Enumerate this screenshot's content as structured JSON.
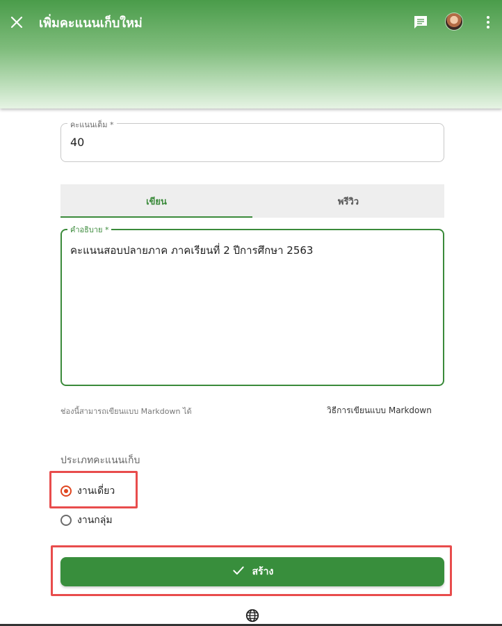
{
  "header": {
    "title": "เพิ่มคะแนนเก็บใหม่",
    "close_icon": "close-icon",
    "chat_icon": "chat-icon",
    "more_icon": "more-vert-icon",
    "gradient_top": "#4a9c4a"
  },
  "form": {
    "max_score": {
      "label": "คะแนนเต็ม *",
      "value": "40"
    },
    "tabs": [
      {
        "label": "เขียน",
        "active": true
      },
      {
        "label": "พรีวิว",
        "active": false
      }
    ],
    "description": {
      "label": "คำอธิบาย *",
      "value": "คะแนนสอบปลายภาค ภาคเรียนที่ 2 ปีการศึกษา 2563"
    },
    "markdown_hint": "ช่องนี้สามารถเขียนแบบ Markdown ได้",
    "markdown_link": "วิธีการเขียนแบบ Markdown",
    "type_title": "ประเภทคะแนนเก็บ",
    "types": [
      {
        "label": "งานเดี่ยว",
        "checked": true
      },
      {
        "label": "งานกลุ่ม",
        "checked": false
      }
    ],
    "submit_label": "สร้าง",
    "submit_icon": "check-icon"
  },
  "footer": {
    "language_icon": "globe-icon"
  },
  "colors": {
    "accent": "#388e3c",
    "radio_selected": "#e0451f",
    "highlight": "#e84c4c"
  }
}
